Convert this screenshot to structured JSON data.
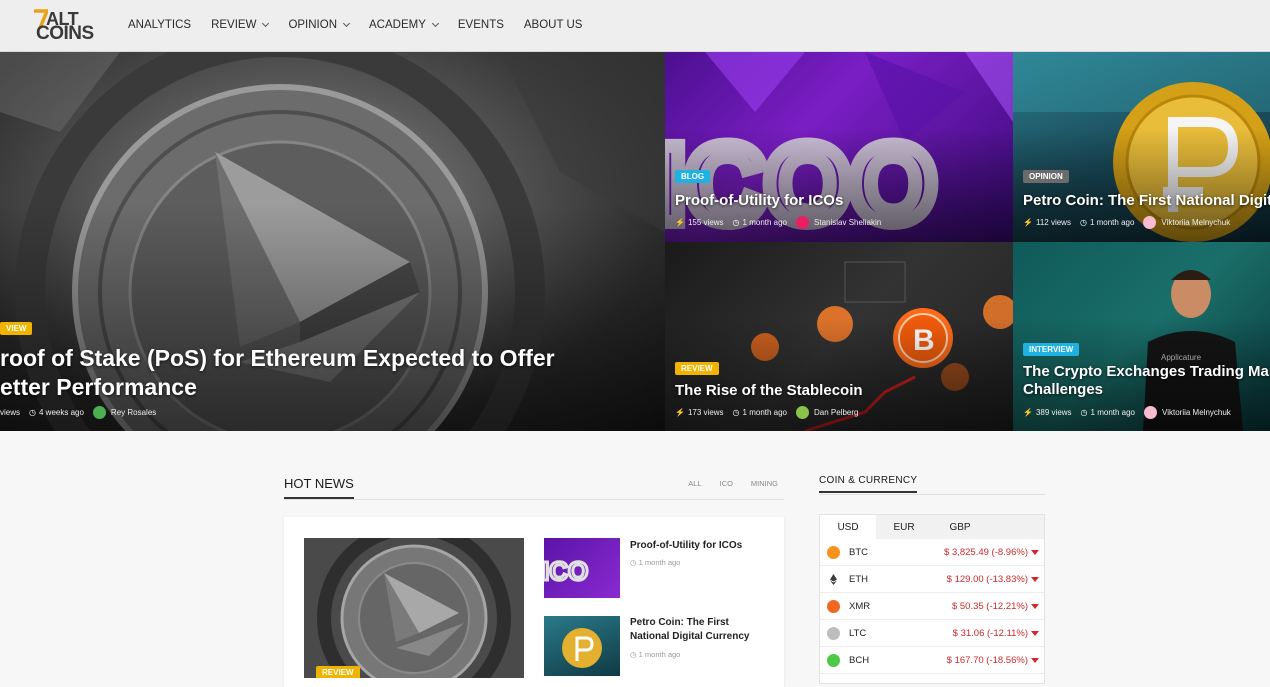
{
  "nav": {
    "logo_top": "ALT",
    "logo_bottom": "COINS",
    "items": [
      {
        "label": "ANALYTICS",
        "dropdown": false
      },
      {
        "label": "REVIEW",
        "dropdown": true
      },
      {
        "label": "OPINION",
        "dropdown": true
      },
      {
        "label": "ACADEMY",
        "dropdown": true
      },
      {
        "label": "EVENTS",
        "dropdown": false
      },
      {
        "label": "ABOUT US",
        "dropdown": false
      }
    ]
  },
  "hero": {
    "main": {
      "badge": "VIEW",
      "title_line1": "roof of Stake (PoS) for Ethereum Expected to Offer",
      "title_line2": "etter Performance",
      "views": "views",
      "time": "4 weeks ago",
      "author": "Rey Rosales"
    },
    "tiles": [
      {
        "badge": "BLOG",
        "badge_color": "#1fb2e0",
        "title": "Proof-of-Utility for ICOs",
        "views": "155 views",
        "time": "1 month ago",
        "author": "Stanislav Sheliakin"
      },
      {
        "badge": "OPINION",
        "badge_color": "#6b6b6b",
        "title": "Petro Coin: The First National Digita",
        "views": "112 views",
        "time": "1 month ago",
        "author": "Viktoriia Melnychuk"
      },
      {
        "badge": "REVIEW",
        "badge_color": "#f0b400",
        "title": "The Rise of the Stablecoin",
        "views": "173 views",
        "time": "1 month ago",
        "author": "Dan Pelberg"
      },
      {
        "badge": "INTERVIEW",
        "badge_color": "#1fb2e0",
        "title_line1": "The Crypto Exchanges Trading Mar",
        "title_line2": "Challenges",
        "views": "389 views",
        "time": "1 month ago",
        "author": "Viktoriia Melnychuk"
      }
    ]
  },
  "hot_news": {
    "title": "HOT NEWS",
    "filters": [
      "ALL",
      "ICO",
      "MINING"
    ],
    "big_badge": "REVIEW",
    "items": [
      {
        "title": "Proof-of-Utility for ICOs",
        "time": "1 month ago"
      },
      {
        "title_line1": "Petro Coin: The First",
        "title_line2": "National Digital Currency",
        "time": "1 month ago"
      }
    ]
  },
  "coins": {
    "title": "COIN & CURRENCY",
    "tabs": [
      "USD",
      "EUR",
      "GBP"
    ],
    "rows": [
      {
        "symbol": "BTC",
        "price": "$ 3,825.49 (-8.96%)",
        "color": "#f7931a"
      },
      {
        "symbol": "ETH",
        "price": "$ 129.00 (-13.83%)",
        "color": "#3c3c3d"
      },
      {
        "symbol": "XMR",
        "price": "$ 50.35 (-12.21%)",
        "color": "#f26822"
      },
      {
        "symbol": "LTC",
        "price": "$ 31.06 (-12.11%)",
        "color": "#bebebe"
      },
      {
        "symbol": "BCH",
        "price": "$ 167.70 (-18.56%)",
        "color": "#4cc947"
      }
    ]
  }
}
